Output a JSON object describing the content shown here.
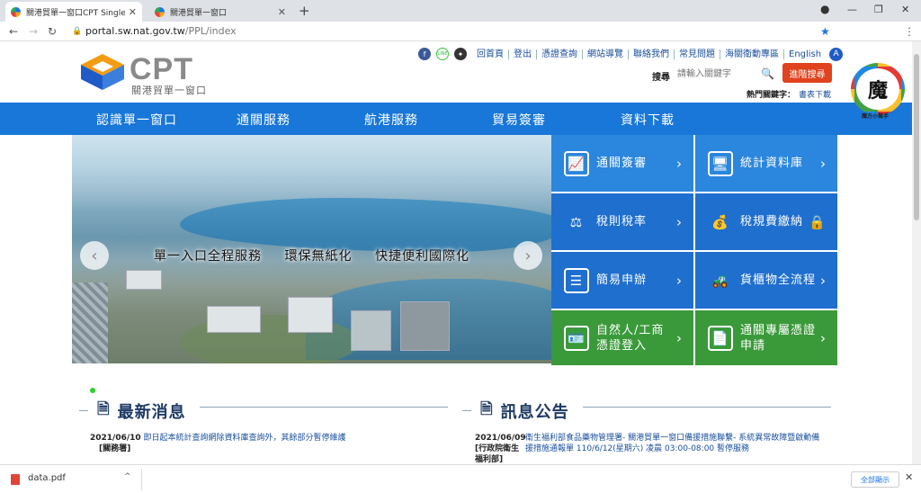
{
  "browser": {
    "tabs": [
      {
        "title": "關港貿單一窗口CPT Single Win",
        "active": true
      },
      {
        "title": "關港貿單一窗口",
        "active": false
      }
    ],
    "url_host": "portal.sw.nat.gov.tw",
    "url_path": "/PPL/index"
  },
  "header": {
    "logo_text": "CPT",
    "logo_sub": "關港貿單一窗口",
    "social_icons": [
      "facebook-icon",
      "line-icon",
      "app-icon"
    ],
    "top_links": [
      "回首頁",
      "登出",
      "憑證查詢",
      "網站導覽",
      "聯絡我們",
      "常見問題",
      "海關衛動專區",
      "English"
    ],
    "accessibility": "A",
    "search_label": "搜尋",
    "search_placeholder": "請輸入關鍵字",
    "advanced_search": "進階搜尋",
    "hot_keywords_label": "熱門關鍵字：",
    "hot_keyword": "書表下載"
  },
  "mainnav": [
    "認識單一窗口",
    "通關服務",
    "航港服務",
    "貿易簽審",
    "資料下載"
  ],
  "hero": {
    "slogans": [
      "單一入口全程服務",
      "環保無紙化",
      "快捷便利國際化"
    ],
    "prev": "‹",
    "next": "›"
  },
  "tiles": [
    {
      "label": "通關簽審",
      "icon": "chart-board-icon"
    },
    {
      "label": "統計資料庫",
      "icon": "monitor-icon"
    },
    {
      "label": "稅則稅率",
      "icon": "scale-icon"
    },
    {
      "label": "稅規費繳納",
      "icon": "payment-icon"
    },
    {
      "label": "簡易申辦",
      "icon": "list-icon"
    },
    {
      "label": "貨櫃物全流程",
      "icon": "forklift-icon"
    },
    {
      "label": "自然人/工商憑證登入",
      "icon": "id-card-icon"
    },
    {
      "label": "通關專屬憑證申請",
      "icon": "certificate-icon"
    }
  ],
  "colors": {
    "nav_blue": "#1877d8",
    "tile_blue_a": "#2b86dd",
    "tile_blue_b": "#1f6fcf",
    "tile_green": "#3a9a3a",
    "accent_red": "#e0431d"
  },
  "news": {
    "title": "最新消息",
    "items": [
      {
        "date": "2021/06/10",
        "source": "[關務署]",
        "text": "即日起本統計查詢網除資料庫查詢外，其餘部分暫停維護"
      }
    ]
  },
  "notices": {
    "title": "訊息公告",
    "items": [
      {
        "date": "2021/06/09",
        "source": "[行政院衛生福利部]",
        "text": "衛生福利部食品藥物管理署- 關港貿單一窗口備援措施聯繫- 系統異常故障暨啟動備援措施通報單 110/6/12(星期六) 凌晨 03:00-08:00 暫停服務"
      }
    ]
  },
  "mascot": {
    "glyph": "魔",
    "caption": "魔方小幫手"
  },
  "downloads": {
    "file": "data.pdf",
    "show_all": "全部顯示"
  }
}
